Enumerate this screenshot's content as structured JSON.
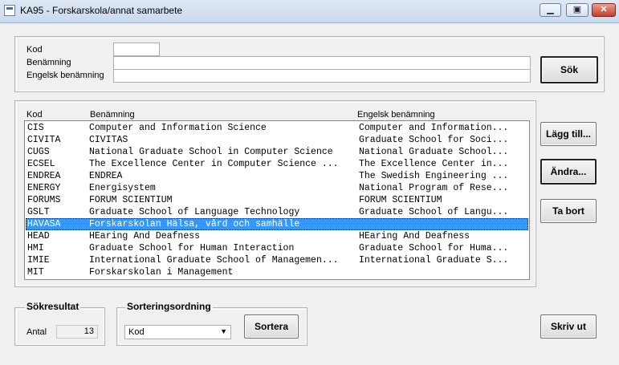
{
  "window": {
    "title": "KA95 - Forskarskola/annat samarbete"
  },
  "search": {
    "kod_label": "Kod",
    "benamning_label": "Benämning",
    "engelsk_label": "Engelsk benämning",
    "kod_value": "",
    "benamning_value": "",
    "engelsk_value": "",
    "search_button": "Sök"
  },
  "list": {
    "headers": [
      "Kod",
      "Benämning",
      "Engelsk benämning"
    ],
    "rows": [
      {
        "kod": "CIS",
        "namn": "Computer and Information Science",
        "eng": "Computer and Information..."
      },
      {
        "kod": "CIVITA",
        "namn": "CIVITAS",
        "eng": "Graduate School for Soci..."
      },
      {
        "kod": "CUGS",
        "namn": "National Graduate School in Computer Science",
        "eng": "National Graduate School..."
      },
      {
        "kod": "ECSEL",
        "namn": "The Excellence Center in Computer Science ...",
        "eng": "The Excellence Center in..."
      },
      {
        "kod": "ENDREA",
        "namn": "ENDREA",
        "eng": "The Swedish Engineering ..."
      },
      {
        "kod": "ENERGY",
        "namn": "Energisystem",
        "eng": "National Program of Rese..."
      },
      {
        "kod": "FORUMS",
        "namn": "FORUM SCIENTIUM",
        "eng": "FORUM SCIENTIUM"
      },
      {
        "kod": "GSLT",
        "namn": "Graduate School of Language Technology",
        "eng": "Graduate School of Langu..."
      },
      {
        "kod": "HAVASA",
        "namn": "Forskarskolan Hälsa, vård och samhälle",
        "eng": ""
      },
      {
        "kod": "HEAD",
        "namn": "HEaring And Deafness",
        "eng": "HEaring And Deafness"
      },
      {
        "kod": "HMI",
        "namn": "Graduate School for Human Interaction",
        "eng": "Graduate School for Huma..."
      },
      {
        "kod": "IMIE",
        "namn": "International Graduate School of Managemen...",
        "eng": "International Graduate S..."
      },
      {
        "kod": "MIT",
        "namn": "Forskarskolan i Management",
        "eng": ""
      }
    ],
    "selected_index": 8
  },
  "actions": {
    "add": "Lägg till...",
    "edit": "Ändra...",
    "delete": "Ta bort",
    "print": "Skriv ut"
  },
  "result": {
    "legend": "Sökresultat",
    "count_label": "Antal",
    "count_value": "13"
  },
  "sort": {
    "legend": "Sorteringsordning",
    "selected": "Kod",
    "button": "Sortera"
  }
}
